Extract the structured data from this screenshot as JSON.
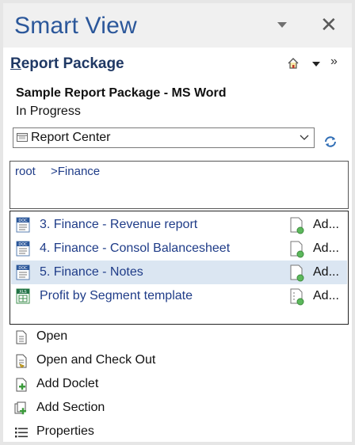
{
  "app": {
    "title": "Smart View"
  },
  "panel": {
    "title_first": "R",
    "title_rest": "eport Package",
    "package_name": "Sample Report Package - MS Word",
    "status": "In Progress"
  },
  "selector": {
    "value": "Report Center"
  },
  "breadcrumb": [
    "root",
    ">Finance"
  ],
  "items": [
    {
      "label": "3. Finance - Revenue report",
      "status": "Ad...",
      "file_type": "DOC",
      "icon": "word-doc-icon"
    },
    {
      "label": "4. Finance - Consol Balancesheet",
      "status": "Ad...",
      "file_type": "DOC",
      "icon": "word-doc-icon"
    },
    {
      "label": "5. Finance - Notes",
      "status": "Ad...",
      "file_type": "DOC",
      "icon": "word-doc-icon",
      "selected": true
    },
    {
      "label": "Profit by Segment template",
      "status": "Ad...",
      "file_type": "XLS",
      "icon": "excel-doc-icon"
    }
  ],
  "actions": [
    {
      "label": "Open",
      "icon": "open-document-icon"
    },
    {
      "label": "Open and Check Out",
      "icon": "check-out-icon"
    },
    {
      "label": "Add Doclet",
      "icon": "add-doclet-icon"
    },
    {
      "label": "Add Section",
      "icon": "add-section-icon"
    },
    {
      "label": "Properties",
      "icon": "properties-icon"
    }
  ],
  "colors": {
    "title_blue": "#2b579a",
    "link_blue": "#1f3c88",
    "selected_row": "#dbe6f2",
    "status_green": "#5cb85c"
  }
}
